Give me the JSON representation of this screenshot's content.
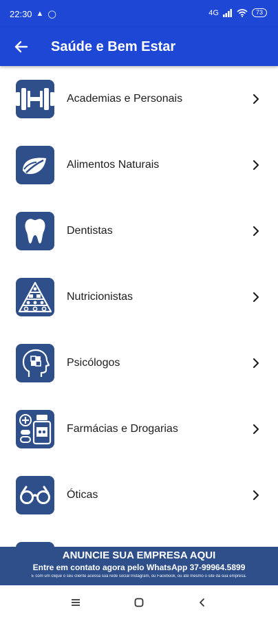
{
  "status": {
    "time": "22:30",
    "network": "4G",
    "battery": "73"
  },
  "appbar": {
    "title": "Saúde e Bem Estar"
  },
  "items": [
    {
      "label": "Academias e Personais",
      "icon": "dumbbell-icon"
    },
    {
      "label": "Alimentos Naturais",
      "icon": "leaf-icon"
    },
    {
      "label": "Dentistas",
      "icon": "tooth-icon"
    },
    {
      "label": "Nutricionistas",
      "icon": "food-pyramid-icon"
    },
    {
      "label": "Psicólogos",
      "icon": "head-puzzle-icon"
    },
    {
      "label": "Farmácias e Drogarias",
      "icon": "medicine-icon"
    },
    {
      "label": "Óticas",
      "icon": "glasses-icon"
    }
  ],
  "banner": {
    "line1": "ANUNCIE SUA EMPRESA AQUI",
    "line2": "Entre em contato agora pelo WhatsApp 37-99964.5899",
    "line3": "E com um clique o seu cliente acessa sua rede social Instagram, ou Facebook, ou até mesmo o site da sua empresa."
  },
  "colors": {
    "primary": "#1e47d6",
    "tile": "#2e4f8a"
  }
}
